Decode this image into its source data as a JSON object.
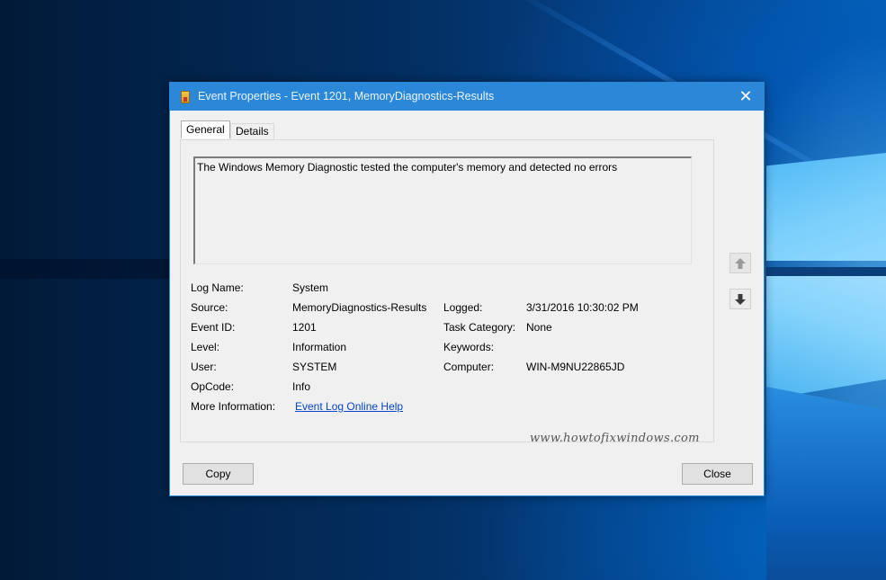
{
  "window": {
    "title": "Event Properties - Event 1201, MemoryDiagnostics-Results",
    "title_icon": "event-viewer-icon",
    "close_glyph": "✕"
  },
  "tabs": [
    {
      "label": "General",
      "active": true
    },
    {
      "label": "Details",
      "active": false
    }
  ],
  "description": "The Windows Memory Diagnostic tested the computer's memory and detected no errors",
  "fields_left": [
    {
      "label": "Log Name:",
      "value": "System"
    },
    {
      "label": "Source:",
      "value": "MemoryDiagnostics-Results"
    },
    {
      "label": "Event ID:",
      "value": "1201"
    },
    {
      "label": "Level:",
      "value": "Information"
    },
    {
      "label": "User:",
      "value": "SYSTEM"
    },
    {
      "label": "OpCode:",
      "value": "Info"
    },
    {
      "label": "More Information:",
      "value": "Event Log Online Help"
    }
  ],
  "fields_right": [
    {
      "label": "Logged:",
      "value": "3/31/2016 10:30:02 PM"
    },
    {
      "label": "Task Category:",
      "value": "None"
    },
    {
      "label": "Keywords:",
      "value": ""
    },
    {
      "label": "Computer:",
      "value": "WIN-M9NU22865JD"
    }
  ],
  "nav": {
    "up_icon": "arrow-up-icon",
    "down_icon": "arrow-down-icon"
  },
  "watermark": "www.howtofixwindows.com",
  "buttons": {
    "copy": "Copy",
    "close": "Close"
  },
  "colors": {
    "titlebar": "#2b88d8",
    "link": "#0645c8",
    "dialog_bg": "#f0f0f0"
  }
}
